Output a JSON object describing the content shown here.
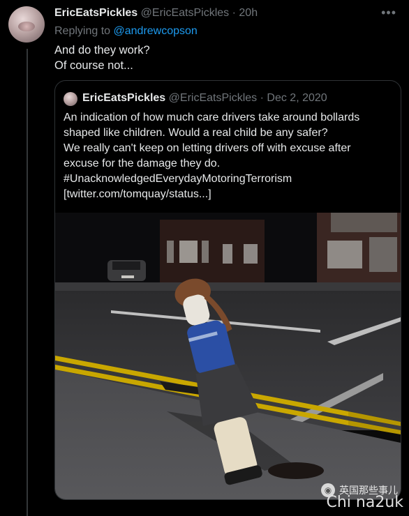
{
  "tweet": {
    "display_name": "EricEatsPickles",
    "handle": "@EricEatsPickles",
    "separator": "·",
    "time": "20h",
    "more_icon": "more-dots-icon",
    "replying_prefix": "Replying to",
    "replying_to": "@andrewcopson",
    "body_lines": [
      "And do they work?",
      "Of course not..."
    ]
  },
  "quoted": {
    "display_name": "EricEatsPickles",
    "handle": "@EricEatsPickles",
    "separator": "·",
    "date": "Dec 2, 2020",
    "lines": [
      "An indication of how much care drivers take around bollards",
      "shaped like children. Would a real child be any safer?",
      "We really can't keep on letting drivers off with excuse after",
      "excuse for the damage they do.",
      "#UnacknowledgedEverydayMotoringTerrorism",
      "[twitter.com/tomquay/status...]"
    ],
    "image_icon": "photo-leaning-child-bollard"
  },
  "watermark": {
    "line1": "英国那些事儿",
    "line2": "Chi na2uk",
    "icon": "wechat-icon"
  },
  "colors": {
    "background": "#000000",
    "text": "#e7e9ea",
    "muted": "#71767b",
    "link": "#1d9bf0",
    "border": "#2f3336"
  }
}
